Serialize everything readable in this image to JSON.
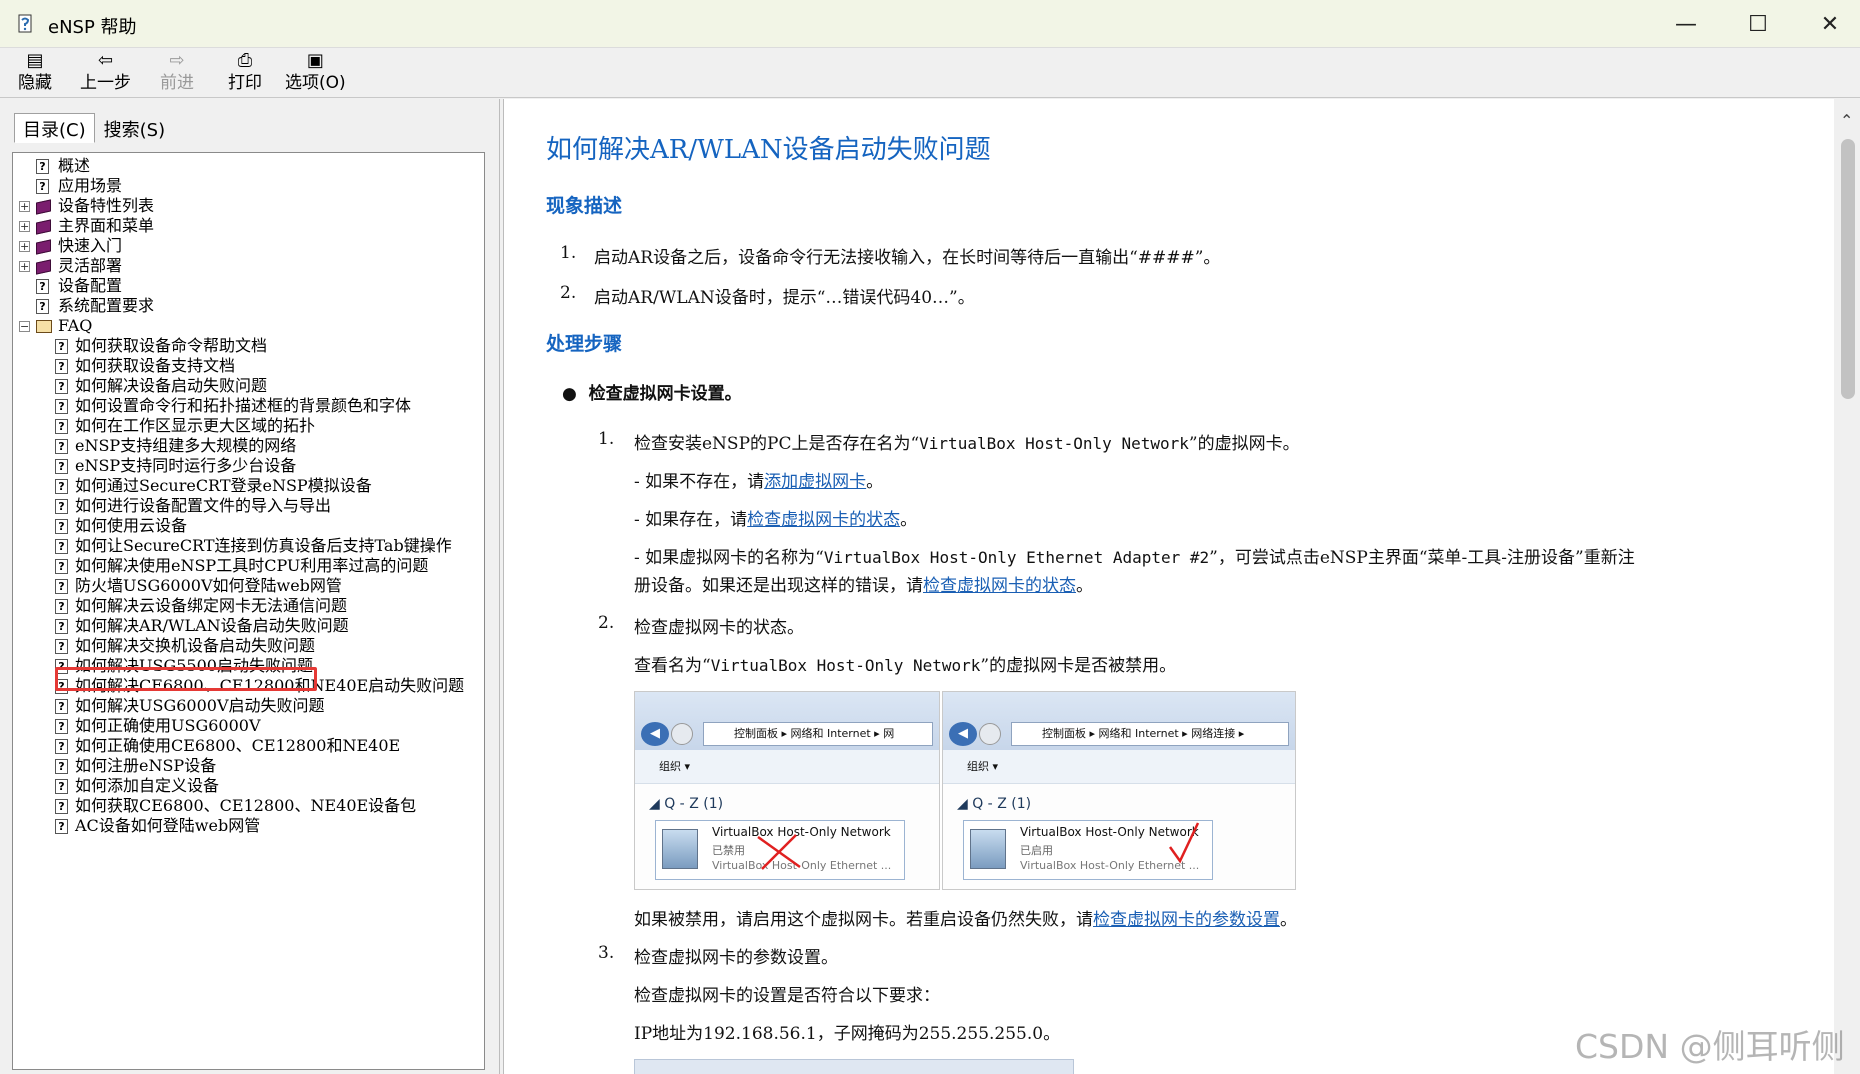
{
  "window": {
    "title": "eNSP 帮助"
  },
  "toolbar": {
    "hide": "隐藏",
    "back": "上一步",
    "forward": "前进",
    "print": "打印",
    "options": "选项(O)"
  },
  "tabs": {
    "contents": "目录(C)",
    "search": "搜索(S)"
  },
  "tree": {
    "top": [
      {
        "label": "概述",
        "type": "page"
      },
      {
        "label": "应用场景",
        "type": "page"
      },
      {
        "label": "设备特性列表",
        "type": "book"
      },
      {
        "label": "主界面和菜单",
        "type": "book"
      },
      {
        "label": "快速入门",
        "type": "book"
      },
      {
        "label": "灵活部署",
        "type": "book"
      },
      {
        "label": "设备配置",
        "type": "page"
      },
      {
        "label": "系统配置要求",
        "type": "page"
      },
      {
        "label": "FAQ",
        "type": "openbook"
      }
    ],
    "faq": [
      "如何获取设备命令帮助文档",
      "如何获取设备支持文档",
      "如何解决设备启动失败问题",
      "如何设置命令行和拓扑描述框的背景颜色和字体",
      "如何在工作区显示更大区域的拓扑",
      "eNSP支持组建多大规模的网络",
      "eNSP支持同时运行多少台设备",
      "如何通过SecureCRT登录eNSP模拟设备",
      "如何进行设备配置文件的导入与导出",
      "如何使用云设备",
      "如何让SecureCRT连接到仿真设备后支持Tab键操作",
      "如何解决使用eNSP工具时CPU利用率过高的问题",
      "防火墙USG6000V如何登陆web网管",
      "如何解决云设备绑定网卡无法通信问题",
      "如何解决AR/WLAN设备启动失败问题",
      "如何解决交换机设备启动失败问题",
      "如何解决USG5500启动失败问题",
      "如何解决CE6800、CE12800和NE40E启动失败问题",
      "如何解决USG6000V启动失败问题",
      "如何正确使用USG6000V",
      "如何正确使用CE6800、CE12800和NE40E",
      "如何注册eNSP设备",
      "如何添加自定义设备",
      "如何获取CE6800、CE12800、NE40E设备包",
      "AC设备如何登陆web网管"
    ]
  },
  "article": {
    "title": "如何解决AR/WLAN设备启动失败问题",
    "section1": "现象描述",
    "symptoms": [
      "启动AR设备之后，设备命令行无法接收输入，在长时间等待后一直输出“####”。",
      "启动AR/WLAN设备时，提示“…错误代码40…”。"
    ],
    "section2": "处理步骤",
    "bullet": "检查虚拟网卡设置。",
    "step1": {
      "num": "1.",
      "pre": "检查安装eNSP的PC上是否存在名为“",
      "mono": "VirtualBox Host-Only Network",
      "post": "”的虚拟网卡。",
      "a_pre": "- 如果不存在，请",
      "a_link": "添加虚拟网卡",
      "a_post": "。",
      "b_pre": "- 如果存在，请",
      "b_link": "检查虚拟网卡的状态",
      "b_post": "。",
      "c_pre": "- 如果虚拟网卡的名称为“",
      "c_mono": "VirtualBox Host-Only Ethernet Adapter #2",
      "c_post": "”，可尝试点击eNSP主界面“菜单-工具-注册设备”重新注",
      "c2_pre": "册设备。如果还是出现这样的错误，请",
      "c2_link": "检查虚拟网卡的状态",
      "c2_post": "。"
    },
    "step2": {
      "num": "2.",
      "text": "检查虚拟网卡的状态。",
      "desc_pre": "查看名为“",
      "desc_mono": "VirtualBox Host-Only Network",
      "desc_post": "”的虚拟网卡是否被禁用。",
      "after_pre": "如果被禁用，请启用这个虚拟网卡。若重启设备仍然失败，请",
      "after_link": "检查虚拟网卡的参数设置",
      "after_post": "。"
    },
    "step3": {
      "num": "3.",
      "text": "检查虚拟网卡的参数设置。",
      "desc": "检查虚拟网卡的设置是否符合以下要求：",
      "ip": "IP地址为192.168.56.1，子网掩码为255.255.255.0。"
    },
    "screens": [
      {
        "crumb": "控制面板  ▸  网络和 Internet  ▸  网",
        "org": "组织 ▾",
        "group": "◢ Q - Z (1)",
        "name": "VirtualBox Host-Only Network",
        "status": "已禁用",
        "adapter": "VirtualBox Host-Only Ethernet ..."
      },
      {
        "crumb": "控制面板  ▸  网络和 Internet  ▸  网络连接  ▸",
        "org": "组织 ▾",
        "group": "◢ Q - Z (1)",
        "name": "VirtualBox Host-Only Network",
        "status": "已启用",
        "adapter": "VirtualBox Host-Only Ethernet ..."
      }
    ]
  },
  "watermark": "CSDN @侧耳听侧",
  "colors": {
    "link": "#1a5fb4",
    "heading": "#1564c0",
    "highlight": "#e53935"
  }
}
